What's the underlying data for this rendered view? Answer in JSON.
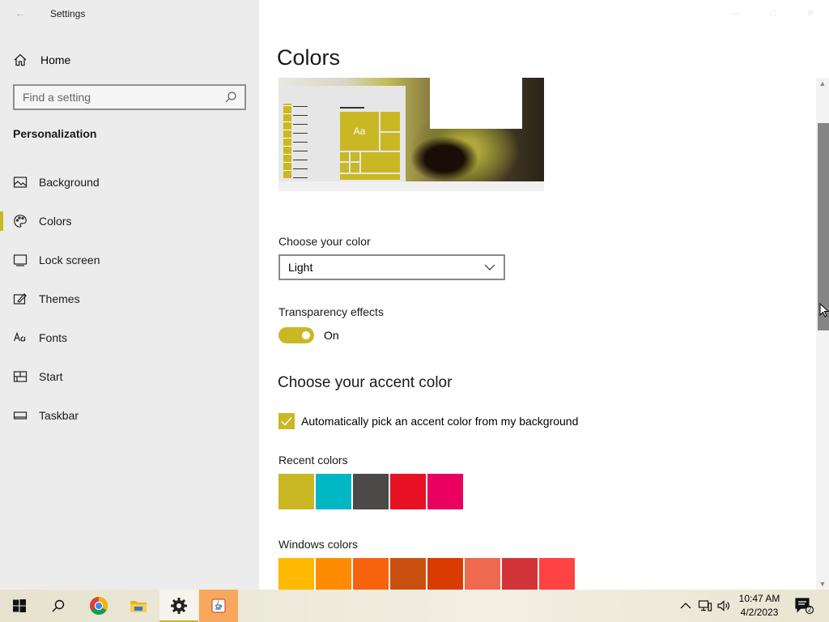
{
  "window": {
    "title": "Settings",
    "back_glyph": "←",
    "controls": [
      "—",
      "□",
      "✕"
    ]
  },
  "sidebar": {
    "home_label": "Home",
    "search_placeholder": "Find a setting",
    "section": "Personalization",
    "items": [
      {
        "label": "Background",
        "icon": "image-icon"
      },
      {
        "label": "Colors",
        "icon": "palette-icon",
        "selected": true
      },
      {
        "label": "Lock screen",
        "icon": "lock-screen-icon"
      },
      {
        "label": "Themes",
        "icon": "themes-icon"
      },
      {
        "label": "Fonts",
        "icon": "fonts-icon"
      },
      {
        "label": "Start",
        "icon": "start-icon"
      },
      {
        "label": "Taskbar",
        "icon": "taskbar-icon"
      }
    ]
  },
  "main": {
    "title": "Colors",
    "preview_tile_text": "Aa",
    "choose_color_label": "Choose your color",
    "choose_color_value": "Light",
    "transparency_label": "Transparency effects",
    "transparency_state": "On",
    "accent_title": "Choose your accent color",
    "auto_accent_label": "Automatically pick an accent color from my background",
    "auto_accent_checked": true,
    "recent_colors_label": "Recent colors",
    "recent_colors": [
      "#c9b824",
      "#00b7c3",
      "#4c4a48",
      "#e81123",
      "#ea005e"
    ],
    "windows_colors_label": "Windows colors",
    "windows_colors": [
      "#ffb900",
      "#ff8c00",
      "#f7630c",
      "#ca5010",
      "#da3b01",
      "#ef6950",
      "#d13438",
      "#ff4343"
    ]
  },
  "theme": {
    "accent": "#c9b824"
  },
  "taskbar": {
    "apps": [
      "start-icon",
      "search-icon",
      "chrome-icon",
      "file-explorer-icon",
      "settings-icon",
      "java-icon"
    ],
    "time": "10:47 AM",
    "date": "4/2/2023",
    "notification_count": "2"
  }
}
